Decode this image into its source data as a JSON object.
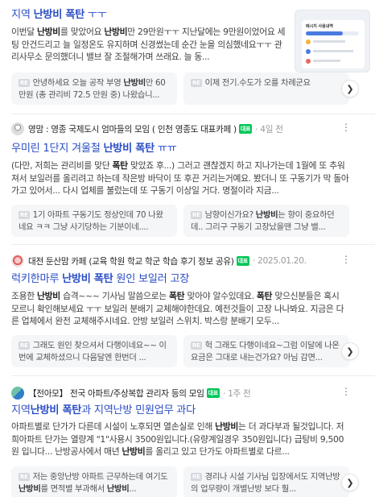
{
  "posts": [
    {
      "title": [
        "지역 ",
        "난방비 폭탄",
        " ㅜㅜ"
      ],
      "desc": "이번달 난방비를 맞았어요 난방비만 29만원ㅜㅜ 지난달에는 9만원이었어요 세팅 안건드리고 늘 일정온도 유지하며 신경썼는데 순간 눈을 의심했네요ㅜㅜ 관리사무소 문의했더니 밸브 잘 조절해가며 쓰래요. 늘 동...",
      "replies": [
        {
          "badge": "RE",
          "text": "안녕하세요 오늘 공작 부영 난방비만 60만원 (총 관리비 72.5 만원 중) 나왔습니..."
        },
        {
          "badge": "RE",
          "text": "이제 전기.수도가 오를 차례군요"
        }
      ]
    },
    {
      "source": "영맘 : 영종 국제도시 엄마들의 모임 ( 인천 영종도 대표카페 )",
      "badge": "대표",
      "date": "4일 전",
      "title": [
        "우미린 1단지 겨울철 ",
        "난방비 폭탄",
        " ㅠㅠ"
      ],
      "desc": "(다만, 저희는 관리비를 맞단 폭탄 맞았죠 후...) 그러고 괜찮겠지 하고 지나가는데 1월에 또 추워져서 보일러를 올리려고 하는데 작은방 바닥이 또 후끈 거리는거예요. 봤더니 또 구동기가 막 돌아가고 있어서... 다시 업체를 불렀는데 또 구동기 이상일 거다. 명절이라 지금...",
      "replies": [
        {
          "badge": "RE",
          "text": "1기 아파트 구동기도 정상인데 70 나왔네요 ㅋㅋ 그냥 사기당하는 기분이네...."
        },
        {
          "badge": "RE",
          "text": "남향이신가요? 난방비는 향이 중요하던데.. 그리구 구동기 고장났을땐 그냥 밸..."
        }
      ]
    },
    {
      "source": "대전 둔산맘 카페 (교육 학원 학교 학군 학습 후기 정보 공유)",
      "badge": "대표",
      "date": "2025.01.20.",
      "title": [
        "럭키한마루 ",
        "난방비 폭탄",
        " 원인 보일러 고장"
      ],
      "desc": "조용한 난방비 습격~~~ 기사님 말씀으로는 폭탄 맞아야 알수있데요. 폭탄 맞으신분들은 혹시 모르니 확인해보세요 ㅜㅜ 보일러 분배기 교체해야한데요. 예전것들이 고장 나나봐요. 지금은 다른 업체에서 완전 교체해주시네요. 안방 보일러 스위치. 박스랑 분배기 모두...",
      "replies": [
        {
          "badge": "RE",
          "text": "그래도 원인 찾으셔서 다행이네요~~ 이번에 교체하셨으니 다음달엔 한번더 ..."
        },
        {
          "badge": "RE",
          "text": "헉 그래도 다행이네요~그럼 이달에 나온 요금은 그대로 내는건가요? 아님 감면..."
        }
      ]
    },
    {
      "source": "【전아모】 전국 아파트/주상복합 관리자 등의 모임",
      "badge": "대표",
      "date": "1주 전",
      "title": [
        "지역",
        "난방비 폭탄",
        "과 지역난방 민원업무 과다"
      ],
      "desc": "아파트별로 단가가 다른데 시설이 노후되면 열손실로 인해 난방비는 더 과다부과 될것입니다. 저희아파트 단가는 열량계 \"1\"사용시 3500원입니다.(유량계일경우 350원입니다) 급탕비 9,500원 입니다... 난방공사에서 매년 난방비를 올리고 있고 단가도 아파트별로 다르...",
      "replies": [
        {
          "badge": "RE",
          "text": "저는 중앙난방 아파트 근무하는데 여기도 난방비를 면적별 부과해서 난방비..."
        },
        {
          "badge": "RE",
          "text": "경리나 시설 기사님 입장에서도 지역난방의 업무량이 개별난방 보다 훨..."
        }
      ]
    }
  ],
  "thumbnail": {
    "title": "메시지 사용내역"
  },
  "icons": {
    "more": "kebab-menu-icon",
    "next": "chevron-right-icon",
    "avatar": "cafe-avatar-icon"
  },
  "colors": {
    "title": "#2a4dc5",
    "cafe_badge": "#03c75a"
  }
}
